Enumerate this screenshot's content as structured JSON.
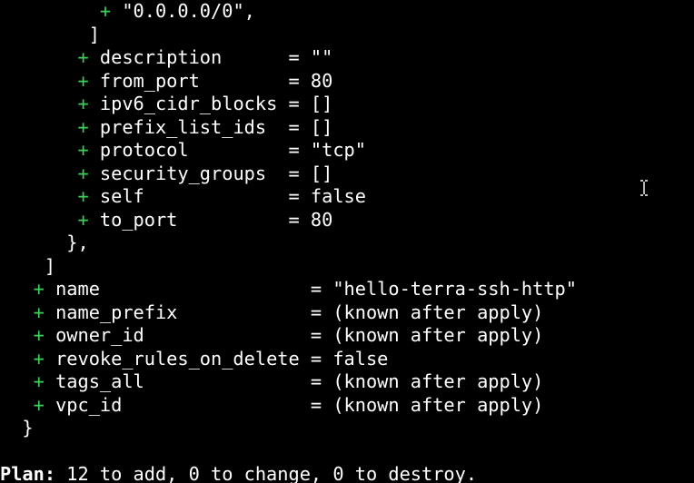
{
  "terminal": {
    "lines": [
      {
        "indent": "         ",
        "plus": "+",
        "text": " \"0.0.0.0/0\","
      },
      {
        "indent": "        ",
        "plus": "",
        "text": "]"
      },
      {
        "indent": "       ",
        "plus": "+",
        "text": " description      = \"\""
      },
      {
        "indent": "       ",
        "plus": "+",
        "text": " from_port        = 80"
      },
      {
        "indent": "       ",
        "plus": "+",
        "text": " ipv6_cidr_blocks = []"
      },
      {
        "indent": "       ",
        "plus": "+",
        "text": " prefix_list_ids  = []"
      },
      {
        "indent": "       ",
        "plus": "+",
        "text": " protocol         = \"tcp\""
      },
      {
        "indent": "       ",
        "plus": "+",
        "text": " security_groups  = []"
      },
      {
        "indent": "       ",
        "plus": "+",
        "text": " self             = false"
      },
      {
        "indent": "       ",
        "plus": "+",
        "text": " to_port          = 80"
      },
      {
        "indent": "      ",
        "plus": "",
        "text": "},"
      },
      {
        "indent": "    ",
        "plus": "",
        "text": "]"
      },
      {
        "indent": "   ",
        "plus": "+",
        "text": " name                   = \"hello-terra-ssh-http\""
      },
      {
        "indent": "   ",
        "plus": "+",
        "text": " name_prefix            = (known after apply)"
      },
      {
        "indent": "   ",
        "plus": "+",
        "text": " owner_id               = (known after apply)"
      },
      {
        "indent": "   ",
        "plus": "+",
        "text": " revoke_rules_on_delete = false"
      },
      {
        "indent": "   ",
        "plus": "+",
        "text": " tags_all               = (known after apply)"
      },
      {
        "indent": "   ",
        "plus": "+",
        "text": " vpc_id                 = (known after apply)"
      },
      {
        "indent": "  ",
        "plus": "",
        "text": "}"
      },
      {
        "indent": "",
        "plus": "",
        "text": ""
      }
    ],
    "plan_label": "Plan:",
    "plan_text": " 12 to add, 0 to change, 0 to destroy."
  },
  "colors": {
    "background": "#000000",
    "foreground": "#ffffff",
    "plus": "#3bd15b"
  },
  "icons": {
    "cursor": "i-beam-cursor-icon"
  }
}
